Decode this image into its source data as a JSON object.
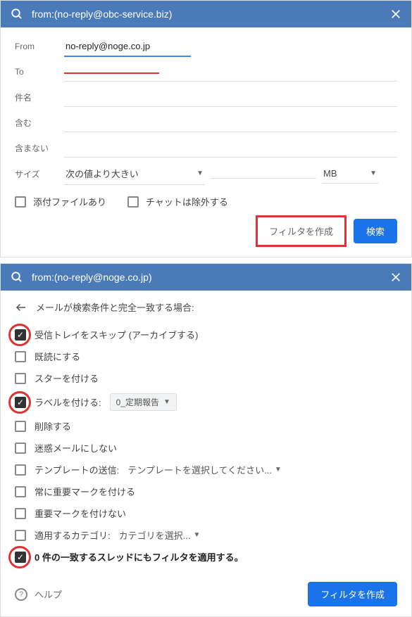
{
  "panel1": {
    "header_query": "from:(no-reply@obc-service.biz)",
    "fields": {
      "from_label": "From",
      "from_value": "no-reply@noge.co.jp",
      "to_label": "To",
      "subject_label": "件名",
      "include_label": "含む",
      "exclude_label": "含まない",
      "size_label": "サイズ",
      "size_operator": "次の値より大きい",
      "size_unit": "MB"
    },
    "checks": {
      "has_attachment": "添付ファイルあり",
      "exclude_chat": "チャットは除外する"
    },
    "buttons": {
      "create_filter": "フィルタを作成",
      "search": "検索"
    }
  },
  "panel2": {
    "header_query": "from:(no-reply@noge.co.jp)",
    "back_label": "メールが検索条件と完全一致する場合:",
    "options": [
      {
        "label": "受信トレイをスキップ (アーカイブする)",
        "checked": true,
        "highlight": true
      },
      {
        "label": "既読にする",
        "checked": false
      },
      {
        "label": "スターを付ける",
        "checked": false
      },
      {
        "label_prefix": "ラベルを付ける:",
        "select_value": "0_定期報告",
        "checked": true,
        "highlight": true,
        "type": "label"
      },
      {
        "label": "削除する",
        "checked": false
      },
      {
        "label": "迷惑メールにしない",
        "checked": false
      },
      {
        "label_prefix": "テンプレートの送信:",
        "select_text": "テンプレートを選択してください...",
        "checked": false,
        "type": "template"
      },
      {
        "label": "常に重要マークを付ける",
        "checked": false
      },
      {
        "label": "重要マークを付けない",
        "checked": false
      },
      {
        "label_prefix": "適用するカテゴリ:",
        "select_text": "カテゴリを選択...",
        "checked": false,
        "type": "category"
      },
      {
        "label": "0 件の一致するスレッドにもフィルタを適用する。",
        "checked": true,
        "highlight": true,
        "bold": true
      }
    ],
    "footer": {
      "help": "ヘルプ",
      "create_filter": "フィルタを作成"
    }
  }
}
